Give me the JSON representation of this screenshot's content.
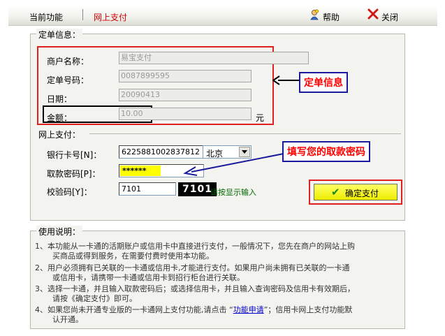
{
  "tabs": {
    "current": "当前功能",
    "active": "网上支付"
  },
  "toolbar": {
    "help": "帮助",
    "close": "关闭"
  },
  "order": {
    "section_title": "定单信息：",
    "merchant_label": "商户名称：",
    "merchant_value": "易宝支付",
    "order_no_label": "定单号码：",
    "order_no_value": "0087899595",
    "date_label": "日期：",
    "date_value": "20090413",
    "amount_label": "金额：",
    "amount_value": "10.00",
    "amount_unit": "元",
    "callout": "定单信息"
  },
  "payment": {
    "section_title": "网上支付：",
    "card_label": "银行卡号[N]：",
    "card_value": "6225881002837812",
    "city_value": "北京",
    "pin_label": "取款密码[P]：",
    "pin_value": "******",
    "verify_label": "校验码[Y]：",
    "verify_value": "7101",
    "captcha": "7101",
    "verify_hint": "请按显示输入",
    "callout": "填写您的取款密码",
    "confirm_button": "确定支付"
  },
  "notes": {
    "title": "使用说明：",
    "items": [
      {
        "l1": "1、本功能从一卡通的活期账户或信用卡中直接进行支付，一般情况下，您先在商户的网站上购",
        "l2": "买商品或得到服务，在需要付费时使用本功能。"
      },
      {
        "l1": "2、用户必须拥有已关联的一卡通或信用卡,才能进行支付。如果用户尚未拥有已关联的一卡通",
        "l2": "或信用卡，请携带一卡通或信用卡到招行柜台进行关联。"
      },
      {
        "l1": "3、选择一卡通，并且输入取款密码后；或选择信用卡，并且输入查询密码及信用卡有效期后，",
        "l2": "请按《确定支付》即可。"
      },
      {
        "l1_pre": "4、如果您尚未开通专业版的一卡通网上支付功能,请点击 “",
        "link": "功能申请",
        "l1_post": "”；信用卡网上支付功能默",
        "l2": "认开通。"
      }
    ]
  },
  "colors": {
    "highlight_red": "#e02020",
    "callout_blue": "#1a1a9c",
    "button_yellow": "#ffff33",
    "pin_yellow": "#ffff00"
  },
  "icons": {
    "help": "help-person-icon",
    "close": "close-x-icon",
    "confirm": "checkmark-icon",
    "callout_arrow": "arrow-left-icon"
  }
}
